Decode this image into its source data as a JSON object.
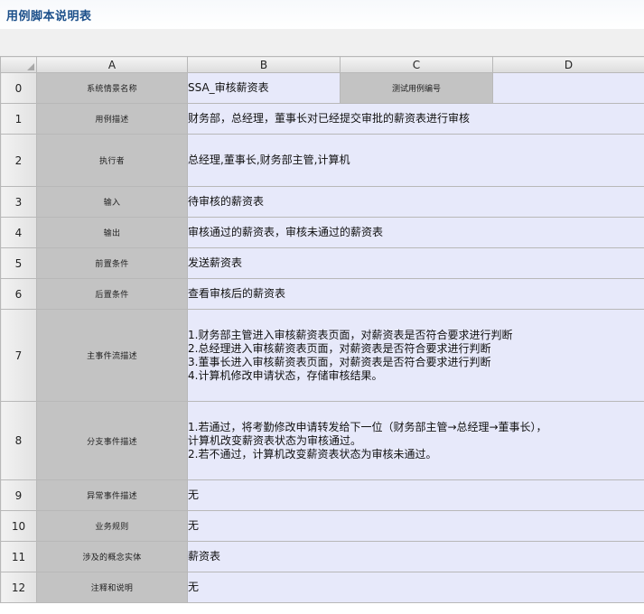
{
  "page": {
    "title": "用例脚本说明表"
  },
  "sheet": {
    "columns": [
      "A",
      "B",
      "C",
      "D"
    ],
    "row0": {
      "num": "0",
      "label": "系统情景名称",
      "value": "SSA_审核薪资表",
      "c_label": "测试用例编号",
      "d_value": ""
    },
    "rows": [
      {
        "num": "1",
        "label": "用例描述",
        "lines": [
          "财务部，总经理，董事长对已经提交审批的薪资表进行审核"
        ]
      },
      {
        "num": "2",
        "label": "执行者",
        "lines": [
          "总经理,董事长,财务部主管,计算机"
        ]
      },
      {
        "num": "3",
        "label": "输入",
        "lines": [
          "待审核的薪资表"
        ]
      },
      {
        "num": "4",
        "label": "输出",
        "lines": [
          "审核通过的薪资表，审核未通过的薪资表"
        ]
      },
      {
        "num": "5",
        "label": "前置条件",
        "lines": [
          "发送薪资表"
        ]
      },
      {
        "num": "6",
        "label": "后置条件",
        "lines": [
          "查看审核后的薪资表"
        ]
      },
      {
        "num": "7",
        "label": "主事件流描述",
        "lines": [
          "1.财务部主管进入审核薪资表页面，对薪资表是否符合要求进行判断",
          "2.总经理进入审核薪资表页面，对薪资表是否符合要求进行判断",
          "3.董事长进入审核薪资表页面，对薪资表是否符合要求进行判断",
          "4.计算机修改申请状态，存储审核结果。"
        ]
      },
      {
        "num": "8",
        "label": "分支事件描述",
        "lines": [
          "1.若通过，将考勤修改申请转发给下一位（财务部主管→总经理→董事长），",
          "计算机改变薪资表状态为审核通过。",
          "2.若不通过，计算机改变薪资表状态为审核未通过。"
        ]
      },
      {
        "num": "9",
        "label": "异常事件描述",
        "lines": [
          "无"
        ]
      },
      {
        "num": "10",
        "label": "业务规则",
        "lines": [
          "无"
        ]
      },
      {
        "num": "11",
        "label": "涉及的概念实体",
        "lines": [
          "薪资表"
        ]
      },
      {
        "num": "12",
        "label": "注释和说明",
        "lines": [
          "无"
        ]
      }
    ]
  }
}
